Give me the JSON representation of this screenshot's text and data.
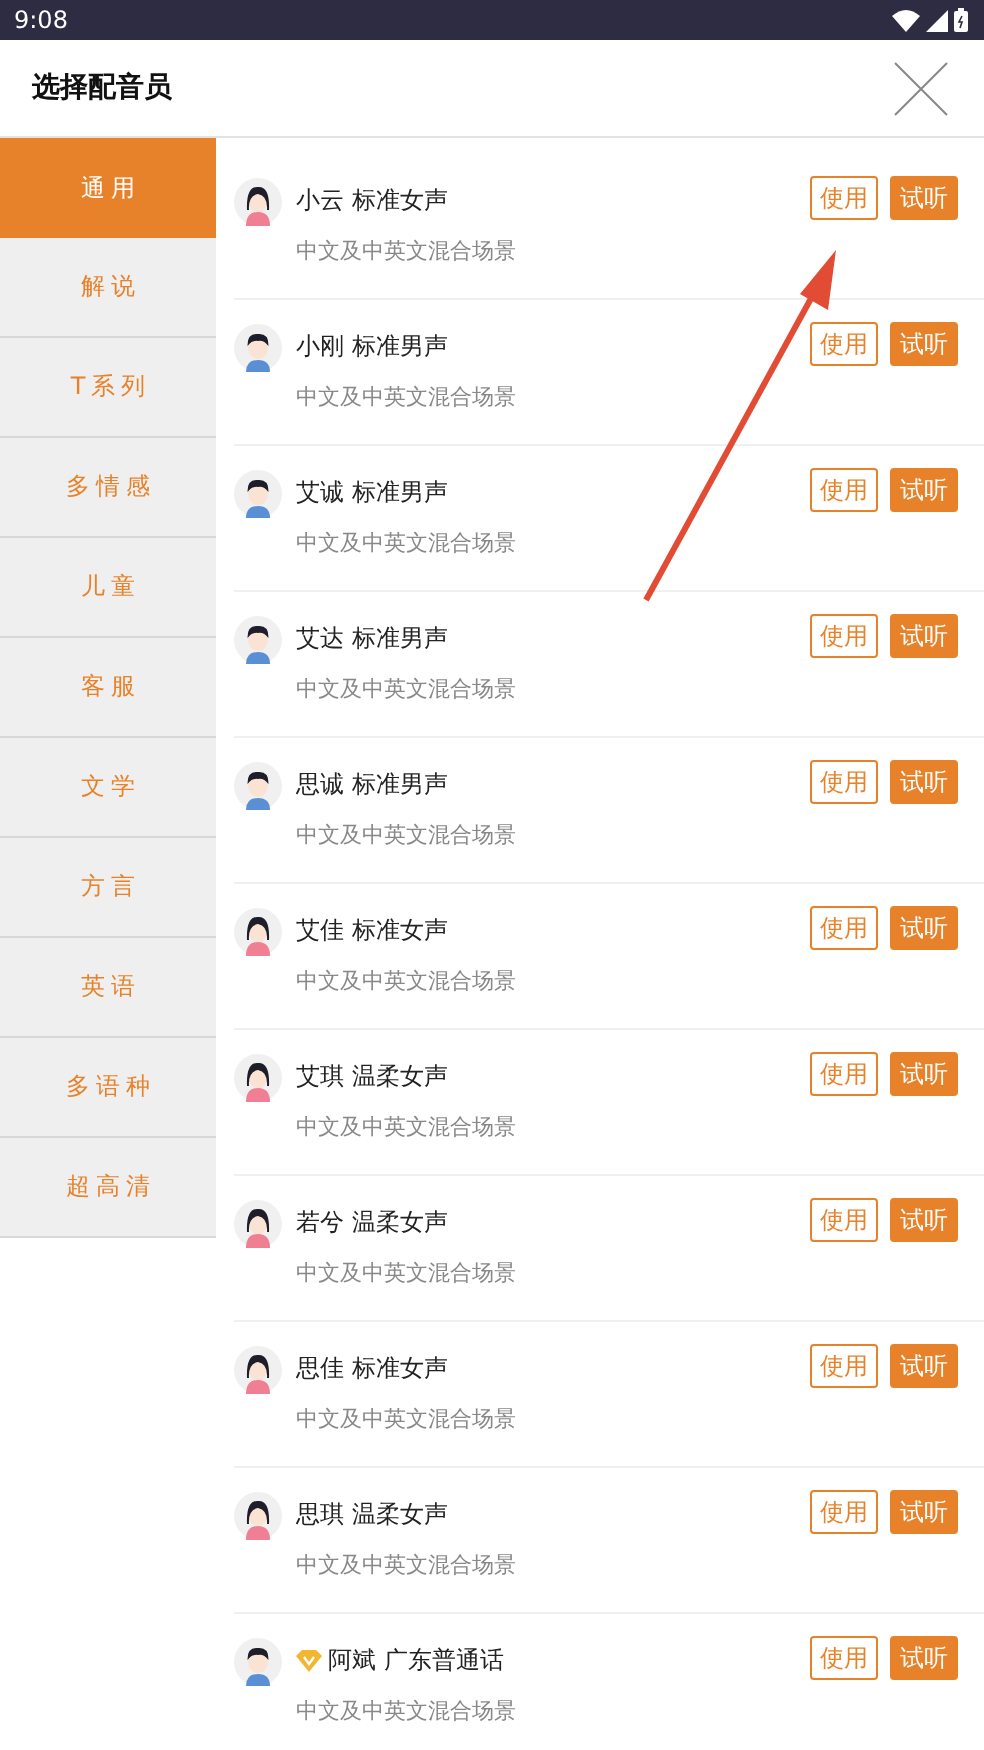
{
  "status_bar": {
    "time": "9:08"
  },
  "header": {
    "title": "选择配音员"
  },
  "sidebar": {
    "items": [
      {
        "label": "通用",
        "selected": true
      },
      {
        "label": "解说",
        "selected": false
      },
      {
        "label": "T系列",
        "selected": false
      },
      {
        "label": "多情感",
        "selected": false
      },
      {
        "label": "儿童",
        "selected": false
      },
      {
        "label": "客服",
        "selected": false
      },
      {
        "label": "文学",
        "selected": false
      },
      {
        "label": "方言",
        "selected": false
      },
      {
        "label": "英语",
        "selected": false
      },
      {
        "label": "多语种",
        "selected": false
      },
      {
        "label": "超高清",
        "selected": false
      }
    ]
  },
  "voices": [
    {
      "kind": "female",
      "vip": false,
      "name": "小云 标准女声",
      "description": "中文及中英文混合场景",
      "use_label": "使用",
      "preview_label": "试听"
    },
    {
      "kind": "male",
      "vip": false,
      "name": "小刚 标准男声",
      "description": "中文及中英文混合场景",
      "use_label": "使用",
      "preview_label": "试听"
    },
    {
      "kind": "male",
      "vip": false,
      "name": "艾诚 标准男声",
      "description": "中文及中英文混合场景",
      "use_label": "使用",
      "preview_label": "试听"
    },
    {
      "kind": "male",
      "vip": false,
      "name": "艾达 标准男声",
      "description": "中文及中英文混合场景",
      "use_label": "使用",
      "preview_label": "试听"
    },
    {
      "kind": "male",
      "vip": false,
      "name": "思诚 标准男声",
      "description": "中文及中英文混合场景",
      "use_label": "使用",
      "preview_label": "试听"
    },
    {
      "kind": "female",
      "vip": false,
      "name": "艾佳 标准女声",
      "description": "中文及中英文混合场景",
      "use_label": "使用",
      "preview_label": "试听"
    },
    {
      "kind": "female",
      "vip": false,
      "name": "艾琪 温柔女声",
      "description": "中文及中英文混合场景",
      "use_label": "使用",
      "preview_label": "试听"
    },
    {
      "kind": "female",
      "vip": false,
      "name": "若兮 温柔女声",
      "description": "中文及中英文混合场景",
      "use_label": "使用",
      "preview_label": "试听"
    },
    {
      "kind": "female",
      "vip": false,
      "name": "思佳 标准女声",
      "description": "中文及中英文混合场景",
      "use_label": "使用",
      "preview_label": "试听"
    },
    {
      "kind": "female",
      "vip": false,
      "name": "思琪 温柔女声",
      "description": "中文及中英文混合场景",
      "use_label": "使用",
      "preview_label": "试听"
    },
    {
      "kind": "male",
      "vip": true,
      "name": "阿斌 广东普通话",
      "description": "中文及中英文混合场景",
      "use_label": "使用",
      "preview_label": "试听"
    }
  ]
}
